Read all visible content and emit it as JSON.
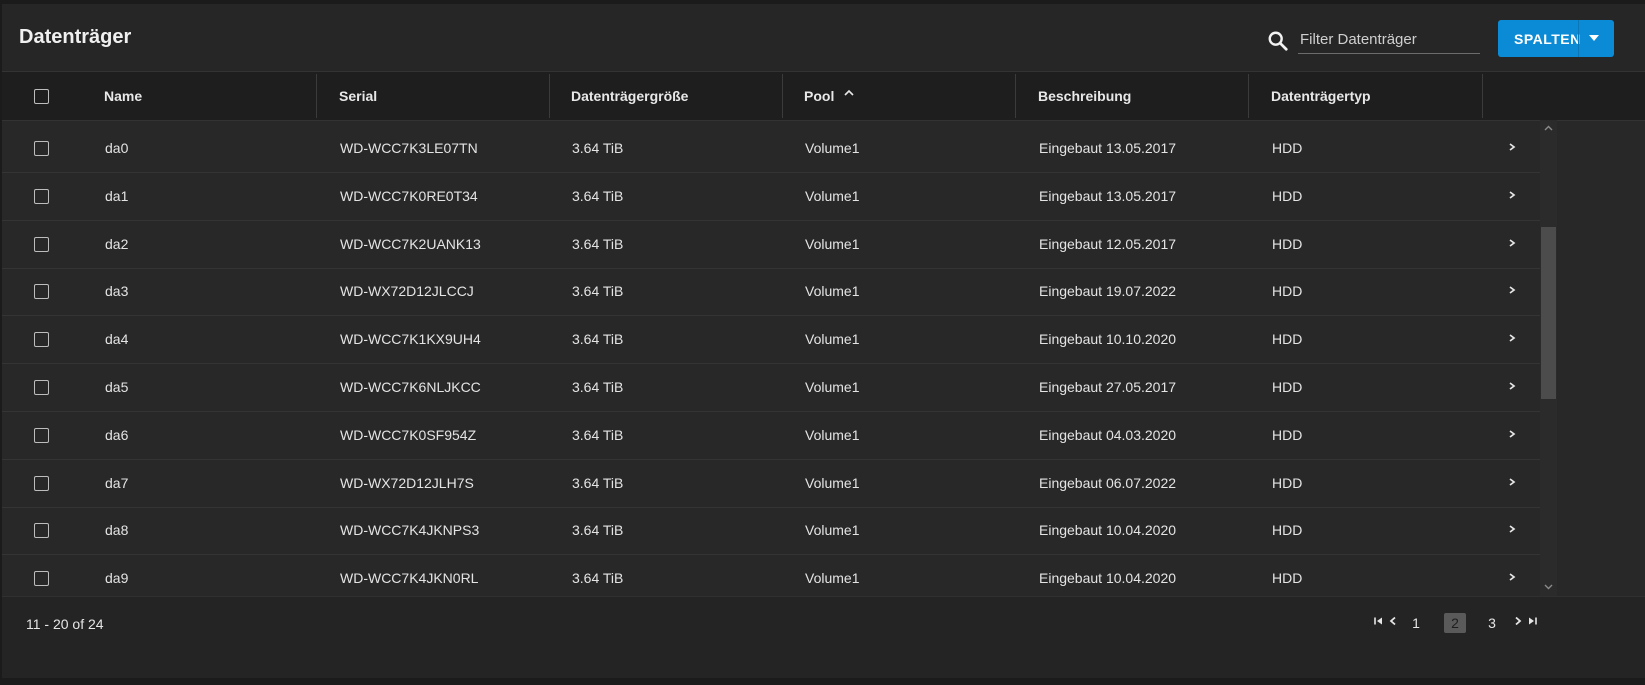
{
  "header": {
    "title": "Datenträger",
    "search_placeholder": "Filter Datenträger",
    "columns_button": "SPALTEN"
  },
  "table": {
    "columns": [
      "Name",
      "Serial",
      "Datenträgergröße",
      "Pool",
      "Beschreibung",
      "Datenträgertyp"
    ],
    "sort_column": "Pool",
    "sort_direction": "ascending",
    "rows": [
      {
        "name": "da0",
        "serial": "WD-WCC7K3LE07TN",
        "size": "3.64 TiB",
        "pool": "Volume1",
        "description": "Eingebaut 13.05.2017",
        "type": "HDD"
      },
      {
        "name": "da1",
        "serial": "WD-WCC7K0RE0T34",
        "size": "3.64 TiB",
        "pool": "Volume1",
        "description": "Eingebaut 13.05.2017",
        "type": "HDD"
      },
      {
        "name": "da2",
        "serial": "WD-WCC7K2UANK13",
        "size": "3.64 TiB",
        "pool": "Volume1",
        "description": "Eingebaut 12.05.2017",
        "type": "HDD"
      },
      {
        "name": "da3",
        "serial": "WD-WX72D12JLCCJ",
        "size": "3.64 TiB",
        "pool": "Volume1",
        "description": "Eingebaut 19.07.2022",
        "type": "HDD"
      },
      {
        "name": "da4",
        "serial": "WD-WCC7K1KX9UH4",
        "size": "3.64 TiB",
        "pool": "Volume1",
        "description": "Eingebaut 10.10.2020",
        "type": "HDD"
      },
      {
        "name": "da5",
        "serial": "WD-WCC7K6NLJKCC",
        "size": "3.64 TiB",
        "pool": "Volume1",
        "description": "Eingebaut 27.05.2017",
        "type": "HDD"
      },
      {
        "name": "da6",
        "serial": "WD-WCC7K0SF954Z",
        "size": "3.64 TiB",
        "pool": "Volume1",
        "description": "Eingebaut 04.03.2020",
        "type": "HDD"
      },
      {
        "name": "da7",
        "serial": "WD-WX72D12JLH7S",
        "size": "3.64 TiB",
        "pool": "Volume1",
        "description": "Eingebaut 06.07.2022",
        "type": "HDD"
      },
      {
        "name": "da8",
        "serial": "WD-WCC7K4JKNPS3",
        "size": "3.64 TiB",
        "pool": "Volume1",
        "description": "Eingebaut 10.04.2020",
        "type": "HDD"
      },
      {
        "name": "da9",
        "serial": "WD-WCC7K4JKN0RL",
        "size": "3.64 TiB",
        "pool": "Volume1",
        "description": "Eingebaut 10.04.2020",
        "type": "HDD"
      }
    ]
  },
  "footer": {
    "range_label": "11 - 20 of 24",
    "pages": [
      "1",
      "2",
      "3"
    ],
    "current_page": "2"
  },
  "colors": {
    "accent": "#0b8bd6",
    "background": "#282828",
    "header_row": "#1e1e1e"
  }
}
